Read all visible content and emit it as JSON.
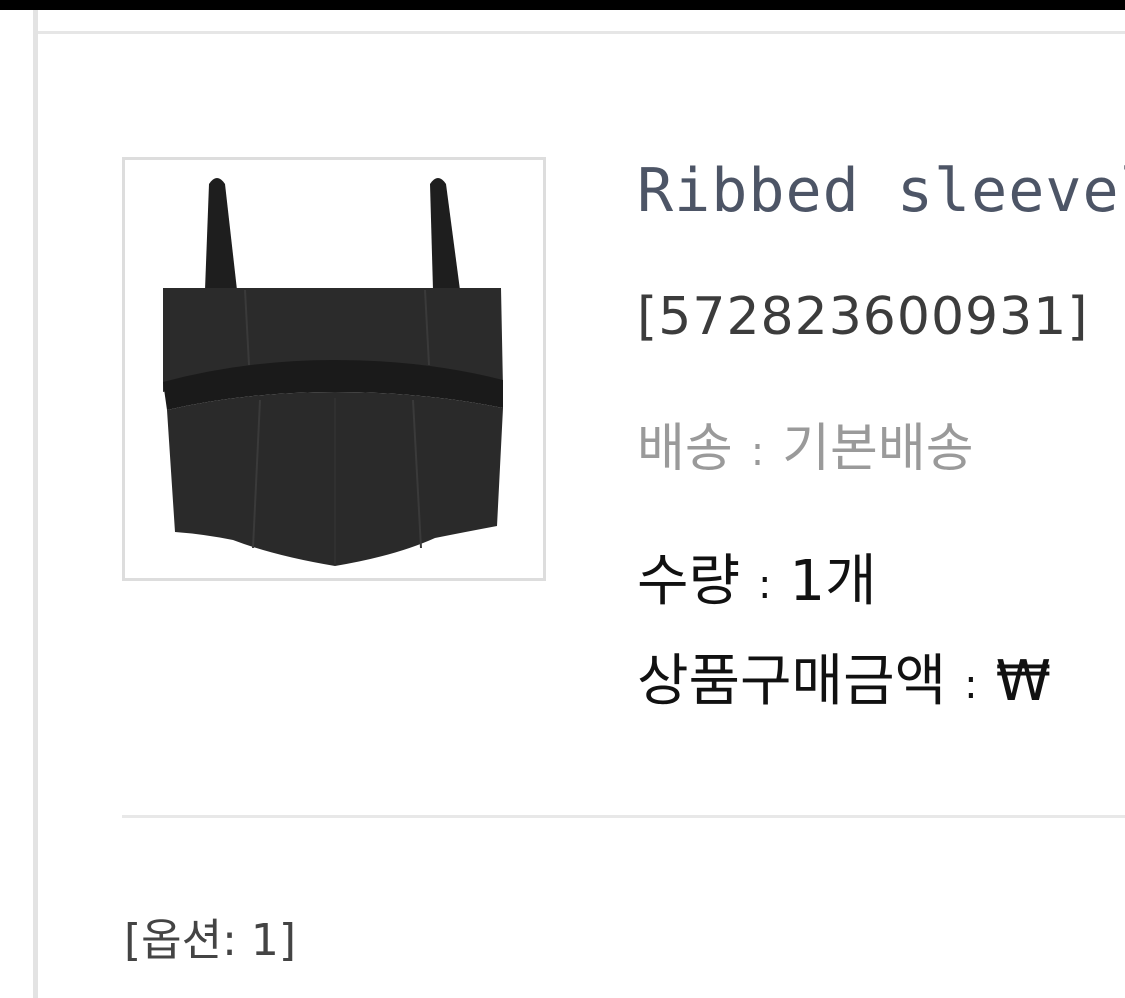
{
  "product": {
    "name": "Ribbed sleevel",
    "code": "[572823600931]",
    "image_icon": "black-ribbed-bustier-top-image"
  },
  "shipping": {
    "label": "배송",
    "separator": ":",
    "value": "기본배송"
  },
  "quantity": {
    "label": "수량",
    "separator": ":",
    "value": "1개"
  },
  "amount": {
    "label": "상품구매금액",
    "separator": ":",
    "value": "₩"
  },
  "option": {
    "text": "[옵션: 1]"
  },
  "colors": {
    "top_bar": "#000000",
    "product_name": "#4d5566",
    "shipping_text": "#9a9a9a",
    "body_text": "#111111",
    "border": "#dddddd"
  }
}
